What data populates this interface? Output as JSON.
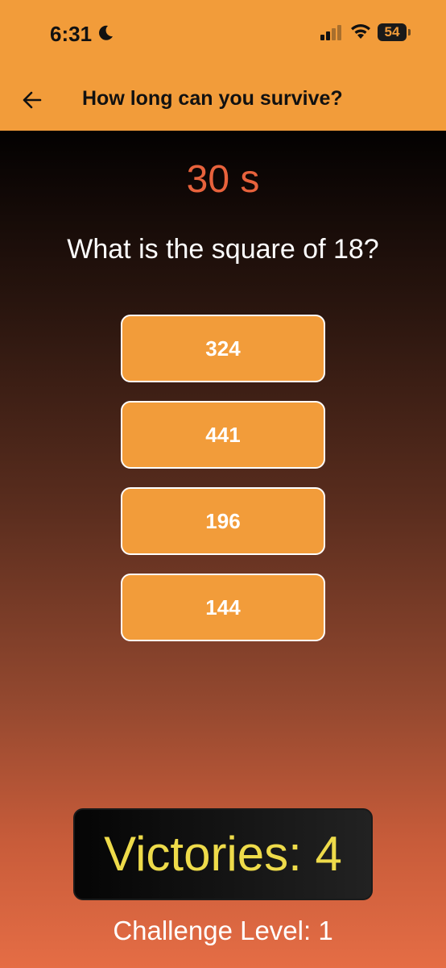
{
  "status_bar": {
    "time": "6:31",
    "battery": "54",
    "icons": [
      "moon-icon",
      "cellular-signal-icon",
      "wifi-icon",
      "battery-icon"
    ]
  },
  "header": {
    "back_icon": "arrow-left-icon",
    "title": "How long can you survive?"
  },
  "game": {
    "timer": "30 s",
    "question": "What is the square of 18?",
    "answers": [
      "324",
      "441",
      "196",
      "144"
    ],
    "victories": "Victories: 4",
    "challenge_level": "Challenge Level: 1"
  },
  "colors": {
    "accent": "#F29C3A",
    "timer": "#E8623C",
    "victories_text": "#EEDB4A"
  }
}
